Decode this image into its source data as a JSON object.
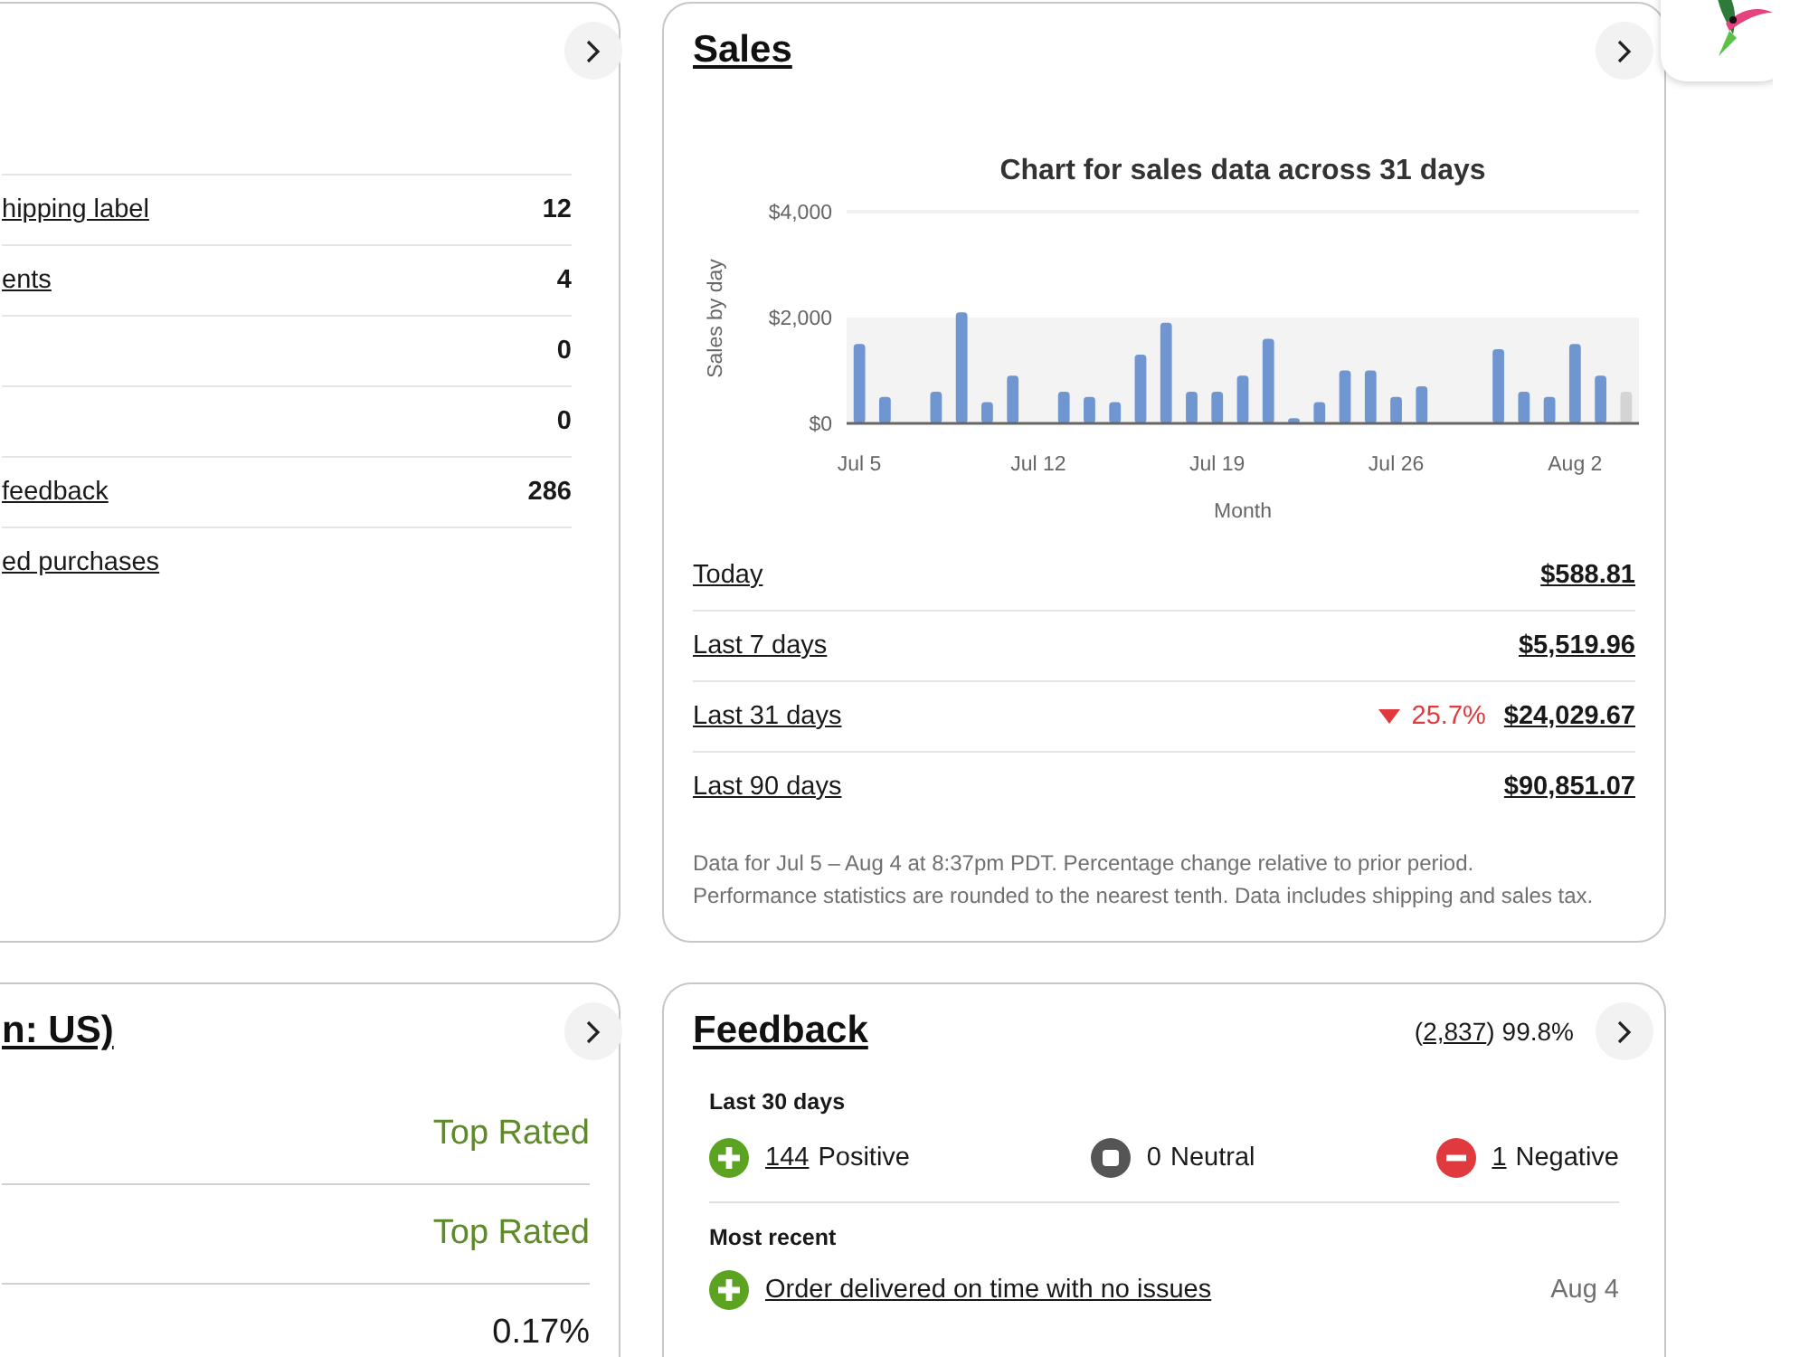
{
  "listings_card": {
    "rows": [
      {
        "label": "hipping label",
        "value": "12"
      },
      {
        "label": "ents",
        "value": "4"
      },
      {
        "value": "0"
      },
      {
        "value": "0"
      },
      {
        "label": "feedback",
        "value": "286"
      },
      {
        "label": "ed purchases"
      }
    ]
  },
  "sales": {
    "title": "Sales",
    "chart_data": {
      "type": "bar",
      "title": "Chart for sales data across 31 days",
      "xlabel": "Month",
      "ylabel": "Sales by day",
      "categories": [
        "Jul 5",
        null,
        null,
        null,
        null,
        null,
        null,
        "Jul 12",
        null,
        null,
        null,
        null,
        null,
        null,
        "Jul 19",
        null,
        null,
        null,
        null,
        null,
        null,
        "Jul 26",
        null,
        null,
        null,
        null,
        null,
        null,
        "Aug 2",
        null,
        null
      ],
      "bands": [
        {
          "axis": "y",
          "from": 0,
          "to": 2000,
          "color": "#f3f3f3"
        }
      ],
      "series": [
        {
          "color": "#6f96d1",
          "values": [
            1500,
            500,
            0,
            600,
            2100,
            400,
            900,
            0,
            600,
            500,
            400,
            1300,
            1900,
            600,
            600,
            900,
            1600,
            100,
            400,
            1000,
            1000,
            500,
            700,
            0,
            0,
            1400,
            600,
            500,
            1500,
            900,
            null
          ]
        },
        {
          "color": "#d4d4d4",
          "values": [
            null,
            null,
            null,
            null,
            null,
            null,
            null,
            null,
            null,
            null,
            null,
            null,
            null,
            null,
            null,
            null,
            null,
            null,
            null,
            null,
            null,
            null,
            null,
            null,
            null,
            null,
            null,
            null,
            null,
            null,
            600
          ]
        }
      ],
      "stacked": false,
      "ylim": [
        0,
        4000
      ],
      "yticks": [
        {
          "value": 0,
          "label": "$0"
        },
        {
          "value": 2000,
          "label": "$2,000"
        },
        {
          "value": 4000,
          "label": "$4,000"
        }
      ]
    },
    "rows": [
      {
        "label": "Today",
        "value": "$588.81"
      },
      {
        "label": "Last 7 days",
        "value": "$5,519.96"
      },
      {
        "label": "Last 31 days",
        "change": "25.7%",
        "declined": true,
        "value": "$24,029.67"
      },
      {
        "label": "Last 90 days",
        "value": "$90,851.07"
      }
    ],
    "note": "Data for Jul 5 – Aug 4 at 8:37pm PDT. Percentage change relative to prior period. Performance statistics are rounded to the nearest tenth. Data includes shipping and sales tax."
  },
  "seller_level_card": {
    "title": "n: US)",
    "rows": [
      {
        "value": "Top Rated",
        "kind": "rating"
      },
      {
        "value": "Top Rated",
        "kind": "rating"
      },
      {
        "value": "0.17%",
        "kind": "plain"
      }
    ]
  },
  "feedback": {
    "title": "Feedback",
    "count_open": "(",
    "count": "2,837",
    "count_close": ")",
    "score": "99.8%",
    "period": "Last 30 days",
    "counts": [
      {
        "kind": "positive",
        "count": "144",
        "linked": true,
        "label": "Positive"
      },
      {
        "kind": "neutral",
        "count": "0",
        "linked": false,
        "label": "Neutral"
      },
      {
        "kind": "negative",
        "count": "1",
        "linked": true,
        "label": "Negative"
      }
    ],
    "recent_title": "Most recent",
    "recent": [
      {
        "kind": "positive",
        "text": "Order delivered on time with no issues",
        "date": "Aug 4"
      }
    ]
  }
}
